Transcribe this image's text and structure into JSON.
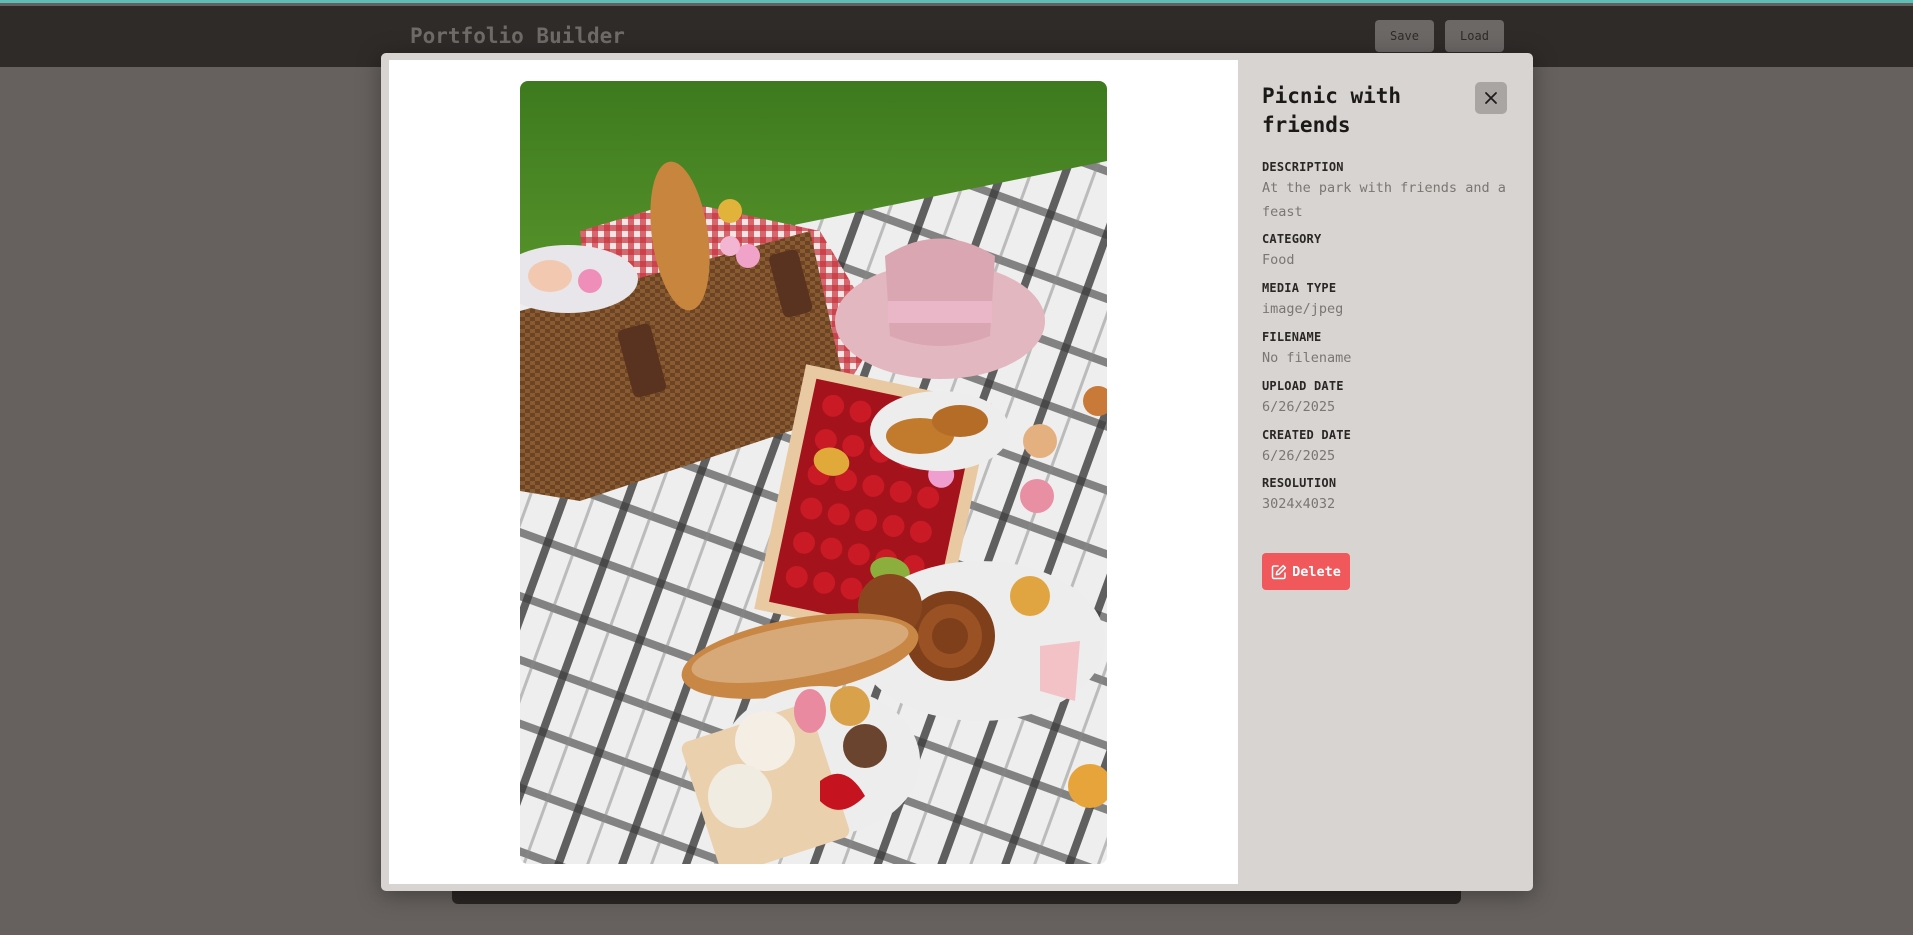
{
  "app": {
    "title": "Portfolio Builder",
    "save_label": "Save",
    "load_label": "Load"
  },
  "modal": {
    "title": "Picnic with friends",
    "close_icon": "close-icon",
    "image_alt": "Picnic spread with basket, strawberries, pastries and hat on a checkered blanket",
    "fields": [
      {
        "label": "DESCRIPTION",
        "value": "At the park with friends and a feast"
      },
      {
        "label": "CATEGORY",
        "value": "Food"
      },
      {
        "label": "MEDIA TYPE",
        "value": "image/jpeg"
      },
      {
        "label": "FILENAME",
        "value": "No filename"
      },
      {
        "label": "UPLOAD DATE",
        "value": "6/26/2025"
      },
      {
        "label": "CREATED DATE",
        "value": "6/26/2025"
      },
      {
        "label": "RESOLUTION",
        "value": "3024x4032"
      }
    ],
    "delete_label": "Delete",
    "delete_icon": "edit-icon"
  },
  "colors": {
    "accent_teal": "#5fbfb7",
    "delete_red": "#f0585b",
    "header_dark": "#2f2b29",
    "info_panel": "#d8d4d1"
  }
}
